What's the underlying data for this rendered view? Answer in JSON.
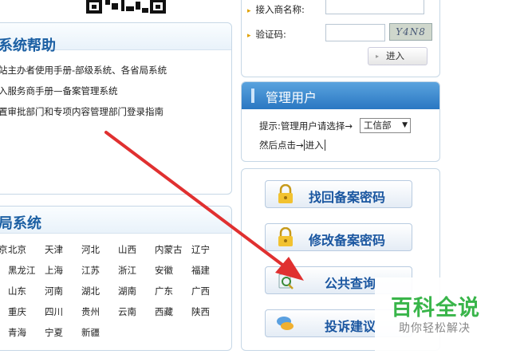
{
  "login": {
    "access_name_label": "接入商名称:",
    "captcha_label": "验证码:",
    "captcha_text": "Y4N8",
    "enter_button": "进入"
  },
  "help": {
    "title": "系统帮助",
    "links": [
      "站主办者使用手册-部级系统、各省局系统",
      "入服务商手册—备案管理系统",
      "置审批部门和专项内容管理部门登录指南"
    ]
  },
  "admin": {
    "title": "管理用户",
    "hint": "提示:管理用户请选择→",
    "select_value": "工信部",
    "then_click": "然后点击→",
    "enter_link": "进入"
  },
  "provincial": {
    "title": "省局系统",
    "rows": [
      [
        "京",
        "北京",
        "天津",
        "河北",
        "山西",
        "内蒙古",
        "辽宁"
      ],
      [
        "",
        "黑龙江",
        "上海",
        "江苏",
        "浙江",
        "安徽",
        "福建"
      ],
      [
        "",
        "山东",
        "河南",
        "湖北",
        "湖南",
        "广东",
        "广西"
      ],
      [
        "",
        "重庆",
        "四川",
        "贵州",
        "云南",
        "西藏",
        "陕西"
      ],
      [
        "",
        "青海",
        "宁夏",
        "新疆",
        "",
        "",
        ""
      ]
    ]
  },
  "services": {
    "retrieve_password": "找回备案密码",
    "change_password": "修改备案密码",
    "public_query": "公共查询",
    "complaint": "投诉建议"
  },
  "watermark": {
    "main": "百科全说",
    "sub": "助你轻松解决"
  },
  "colors": {
    "title_blue": "#1b5fa3",
    "arrow_red": "#e03030",
    "watermark_green": "#39b54a"
  }
}
